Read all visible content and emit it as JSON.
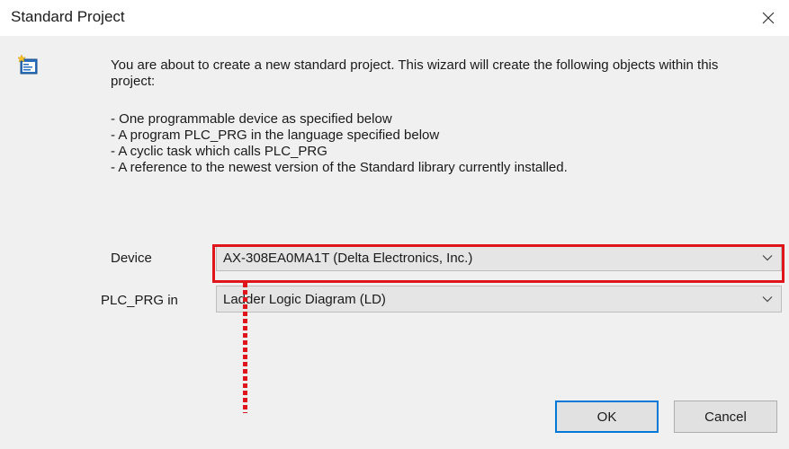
{
  "window": {
    "title": "Standard Project"
  },
  "intro": {
    "text": "You are about to create a new standard project. This wizard will create the following objects within this project:"
  },
  "bullets": [
    "- One programmable device as specified below",
    "- A program PLC_PRG in the language specified below",
    "- A cyclic task which calls PLC_PRG",
    "- A reference to the newest version of the Standard library currently installed."
  ],
  "fields": {
    "device": {
      "label": "Device",
      "value": "AX-308EA0MA1T (Delta Electronics, Inc.)"
    },
    "plc_prg": {
      "label": "PLC_PRG in",
      "value": "Ladder Logic Diagram (LD)"
    }
  },
  "buttons": {
    "ok": "OK",
    "cancel": "Cancel"
  },
  "icons": {
    "close": "close-icon",
    "wizard": "new-project-wizard-icon",
    "dropdown": "chevron-down-icon"
  },
  "colors": {
    "dialog_background": "#f0f0f0",
    "highlight": "#e0151b",
    "default_button_border": "#0078d7"
  }
}
